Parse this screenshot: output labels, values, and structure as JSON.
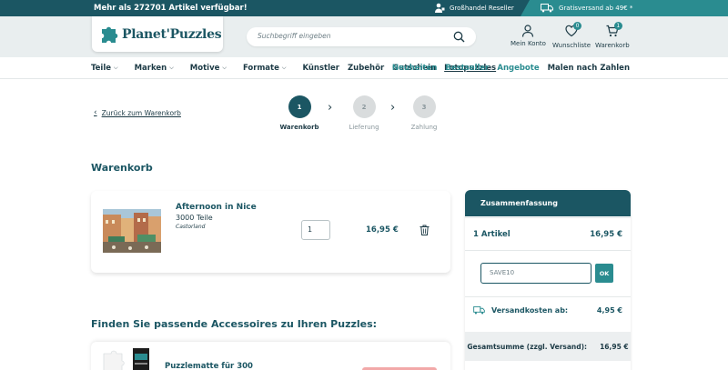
{
  "topbar": {
    "promo": "Mehr als 272701 Artikel verfügbar!",
    "reseller": "Großhandel Reseller",
    "shipping": "Gratisversand ab 49€ *"
  },
  "header": {
    "logo_text": "Planet'Puzzles",
    "search_placeholder": "Suchbegriff eingeben",
    "account": "Mein Konto",
    "wishlist": "Wunschliste",
    "wishlist_count": "0",
    "cart": "Warenkorb",
    "cart_count": "1"
  },
  "nav": {
    "left": [
      {
        "label": "Teile",
        "chevron": true
      },
      {
        "label": "Marken",
        "chevron": true
      },
      {
        "label": "Motive",
        "chevron": true
      },
      {
        "label": "Formate",
        "chevron": true
      },
      {
        "label": "Künstler",
        "chevron": false
      },
      {
        "label": "Zubehör",
        "chevron": false
      },
      {
        "label": "Gutschein",
        "chevron": false
      },
      {
        "label": "Fotopuzzles",
        "chevron": false
      }
    ],
    "right": [
      "Neuheiten",
      "Bestseller",
      "Angebote",
      "Malen nach Zahlen"
    ]
  },
  "back_link": "Zurück zum Warenkorb",
  "steps": [
    {
      "num": "1",
      "label": "Warenkorb"
    },
    {
      "num": "2",
      "label": "Lieferung"
    },
    {
      "num": "3",
      "label": "Zahlung"
    }
  ],
  "cart": {
    "heading": "Warenkorb",
    "item": {
      "name": "Afternoon in Nice",
      "pieces": "3000 Teile",
      "brand": "Castorland",
      "quantity": "1",
      "price": "16,95 €"
    }
  },
  "summary": {
    "heading": "Zusammenfassung",
    "items_label": "1 Artikel",
    "items_price": "16,95 €",
    "coupon_value": "SAVE10",
    "ok_label": "OK",
    "shipping_label": "Versandkosten ab:",
    "shipping_price": "4,95 €",
    "total_label": "Gesamtsumme (zzgl. Versand):",
    "total_price": "16,95 €"
  },
  "accessories": {
    "heading": "Finden Sie passende Accessoires zu Ihren Puzzles:",
    "item_name": "Puzzlematte für 300"
  },
  "colors": {
    "primary": "#1b5663",
    "accent": "#2a8c90",
    "header_bg": "#e9eeef"
  }
}
